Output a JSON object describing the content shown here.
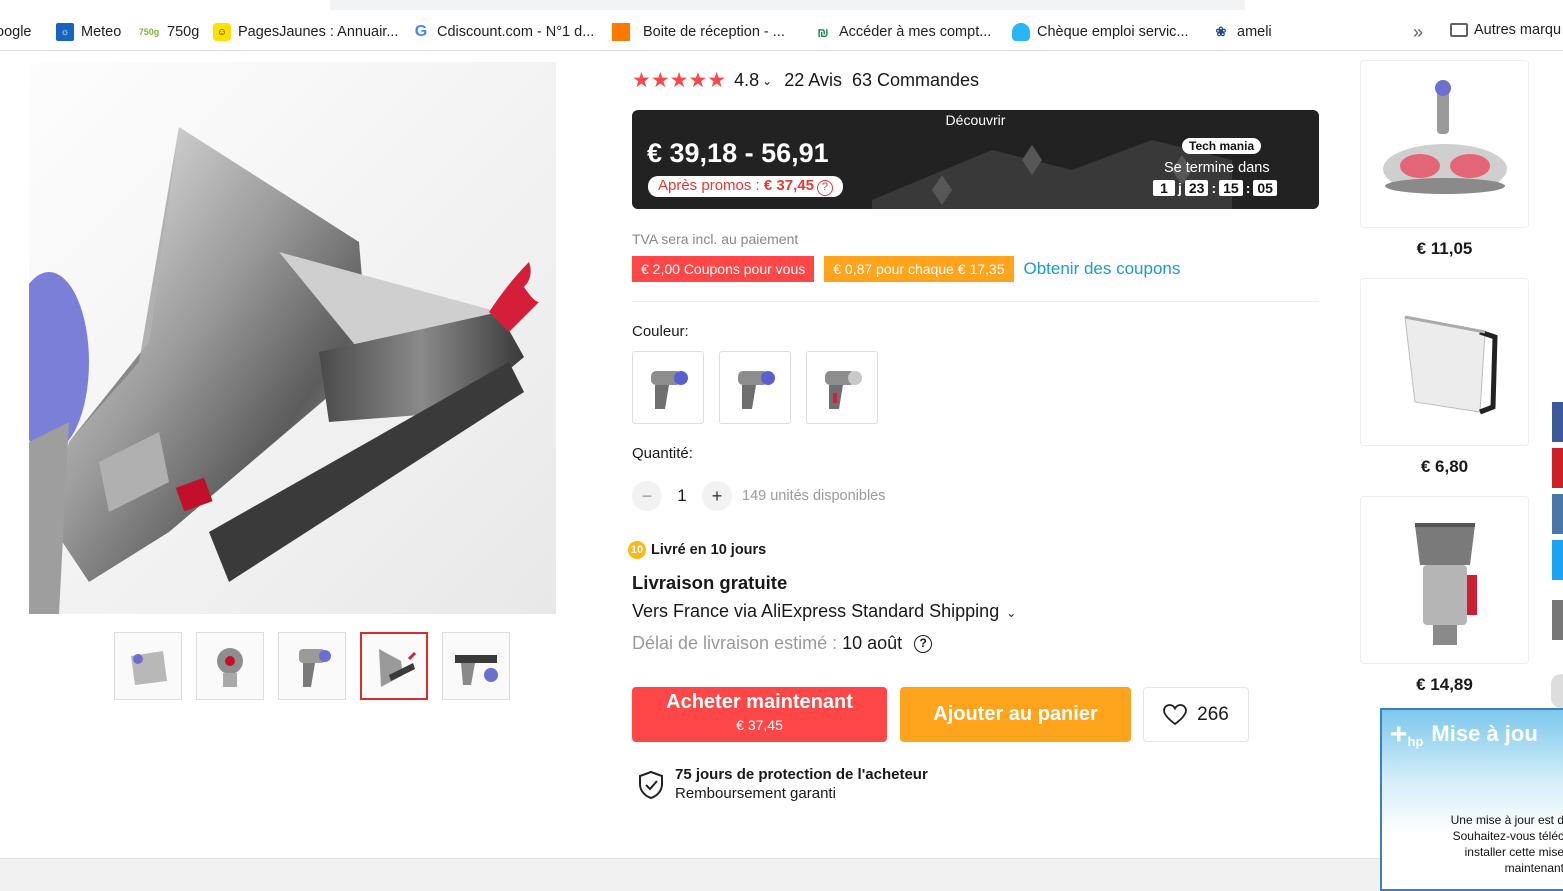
{
  "bookmarks": [
    {
      "label": "oogle",
      "icon": "google-icon"
    },
    {
      "label": "Meteo",
      "icon": "meteo-icon"
    },
    {
      "label": "750g",
      "icon": "750g-icon"
    },
    {
      "label": "PagesJaunes : Annuair...",
      "icon": "pagesjaunes-icon"
    },
    {
      "label": "Cdiscount.com - N°1 d...",
      "icon": "google-g-icon"
    },
    {
      "label": "Boite de réception - ...",
      "icon": "orange-icon"
    },
    {
      "label": "Accéder à mes compt...",
      "icon": "bank-icon"
    },
    {
      "label": "Chèque emploi servic...",
      "icon": "cesu-icon"
    },
    {
      "label": "ameli",
      "icon": "ameli-icon"
    }
  ],
  "bookmarks_more": "Autres marqu",
  "product": {
    "rating": "4.8",
    "reviews": "22 Avis",
    "orders": "63 Commandes",
    "promo": {
      "header": "Découvrir",
      "price_range": "€ 39,18 - 56,91",
      "after_promo_label": "Après promos : ",
      "after_promo_price": "€ 37,45",
      "store_badge": "Tech mania",
      "ends_label": "Se termine dans",
      "timer": {
        "days": "1",
        "day_unit": "j",
        "hours": "23",
        "minutes": "15",
        "seconds": "05"
      }
    },
    "tva": "TVA sera incl. au paiement",
    "coupon1": "€ 2,00 Coupons pour vous",
    "coupon2": "€ 0,87 pour chaque € 17,35",
    "get_coupons": "Obtenir des coupons",
    "color_label": "Couleur:",
    "quantity_label": "Quantité:",
    "quantity": "1",
    "available": "149 unités disponibles",
    "delivery_badge": "Livré en 10 jours",
    "shipping_title": "Livraison gratuite",
    "shipping_to": "Vers France via AliExpress Standard Shipping",
    "delivery_estimate_label": "Délai de livraison estimé :",
    "delivery_estimate_value": "10 août",
    "buy_now": "Acheter maintenant",
    "buy_now_price": "€ 37,45",
    "add_to_cart": "Ajouter au panier",
    "wishlist_count": "266",
    "protection_title": "75 jours de protection de l'acheteur",
    "protection_sub": "Remboursement garanti"
  },
  "recommendations": [
    {
      "price": "€ 11,05"
    },
    {
      "price": "€ 6,80"
    },
    {
      "price": "€ 14,89"
    }
  ],
  "hp_popup": {
    "title": "Mise à jou",
    "brand": "hp",
    "lines": [
      "Une mise à jour est d",
      "Souhaitez-vous téléc",
      "installer cette mise",
      "maintenant"
    ]
  },
  "colors": {
    "accent_red": "#ff4747",
    "accent_orange": "#ffa41c",
    "link_blue": "#1a9acf"
  }
}
